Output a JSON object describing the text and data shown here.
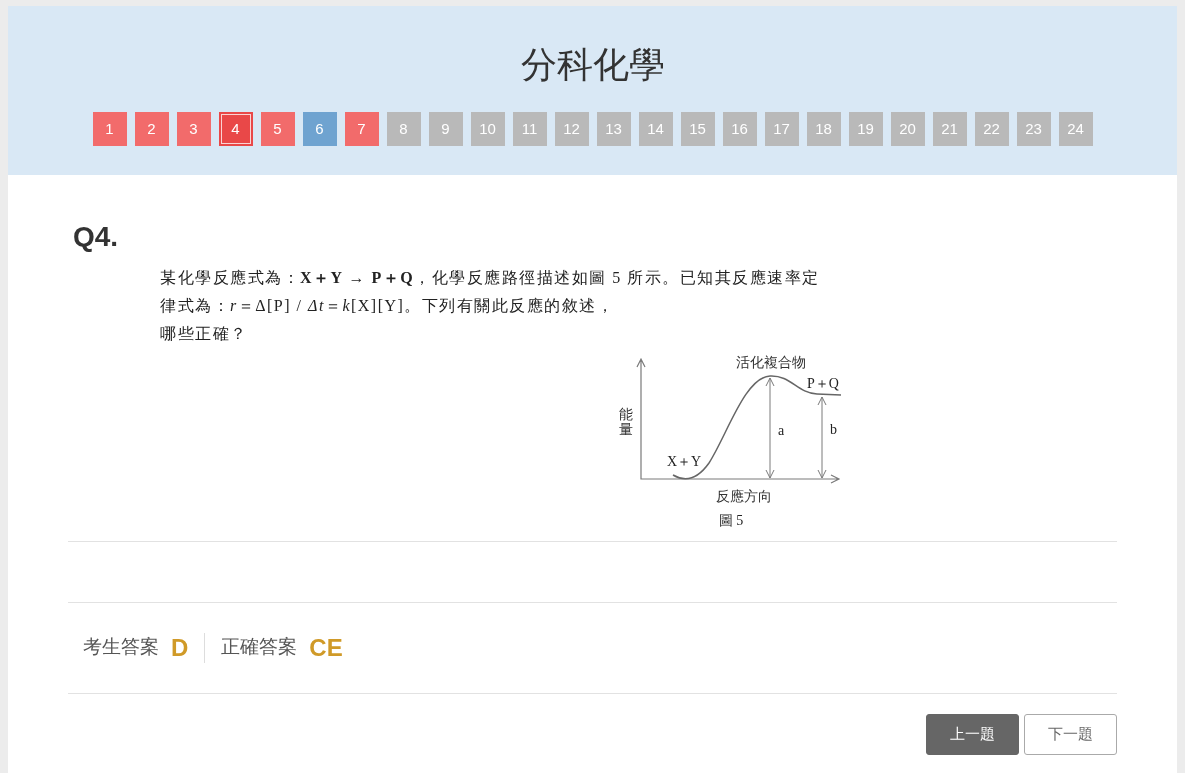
{
  "header": {
    "title": "分科化學",
    "questions": [
      {
        "number": "1",
        "color": "#f26b6b",
        "selected": false
      },
      {
        "number": "2",
        "color": "#f26b6b",
        "selected": false
      },
      {
        "number": "3",
        "color": "#f26b6b",
        "selected": false
      },
      {
        "number": "4",
        "color": "#e94848",
        "selected": true
      },
      {
        "number": "5",
        "color": "#f26b6b",
        "selected": false
      },
      {
        "number": "6",
        "color": "#6fa3d0",
        "selected": false
      },
      {
        "number": "7",
        "color": "#f26b6b",
        "selected": false
      },
      {
        "number": "8",
        "color": "#b9b9b9",
        "selected": false
      },
      {
        "number": "9",
        "color": "#b9b9b9",
        "selected": false
      },
      {
        "number": "10",
        "color": "#b9b9b9",
        "selected": false
      },
      {
        "number": "11",
        "color": "#b9b9b9",
        "selected": false
      },
      {
        "number": "12",
        "color": "#b9b9b9",
        "selected": false
      },
      {
        "number": "13",
        "color": "#b9b9b9",
        "selected": false
      },
      {
        "number": "14",
        "color": "#b9b9b9",
        "selected": false
      },
      {
        "number": "15",
        "color": "#b9b9b9",
        "selected": false
      },
      {
        "number": "16",
        "color": "#b9b9b9",
        "selected": false
      },
      {
        "number": "17",
        "color": "#b9b9b9",
        "selected": false
      },
      {
        "number": "18",
        "color": "#b9b9b9",
        "selected": false
      },
      {
        "number": "19",
        "color": "#b9b9b9",
        "selected": false
      },
      {
        "number": "20",
        "color": "#b9b9b9",
        "selected": false
      },
      {
        "number": "21",
        "color": "#b9b9b9",
        "selected": false
      },
      {
        "number": "22",
        "color": "#b9b9b9",
        "selected": false
      },
      {
        "number": "23",
        "color": "#b9b9b9",
        "selected": false
      },
      {
        "number": "24",
        "color": "#b9b9b9",
        "selected": false
      }
    ]
  },
  "question": {
    "label": "Q4.",
    "text": "某化學反應式為：**X＋Y → P＋Q**，化學反應路徑描述如圖 5 所示。已知其反應速率定律式為：*r*＝Δ[P] / *Δt*＝*k*[X][Y]。下列有關此反應的敘述，哪些正確？",
    "figure": {
      "peak_label": "活化複合物",
      "product_label": "P＋Q",
      "gap_a_label": "a",
      "gap_b_label": "b",
      "reactant_label": "X＋Y",
      "y_axis_label": "能量",
      "x_axis_label": "反應方向",
      "caption": "圖 5"
    }
  },
  "answers": [
    {
      "label": "考生答案",
      "value": "D"
    },
    {
      "label": "正確答案",
      "value": "CE"
    }
  ],
  "buttons": [
    {
      "label": "上一題",
      "kind": "filled"
    },
    {
      "label": "下一題",
      "kind": "outline"
    }
  ]
}
